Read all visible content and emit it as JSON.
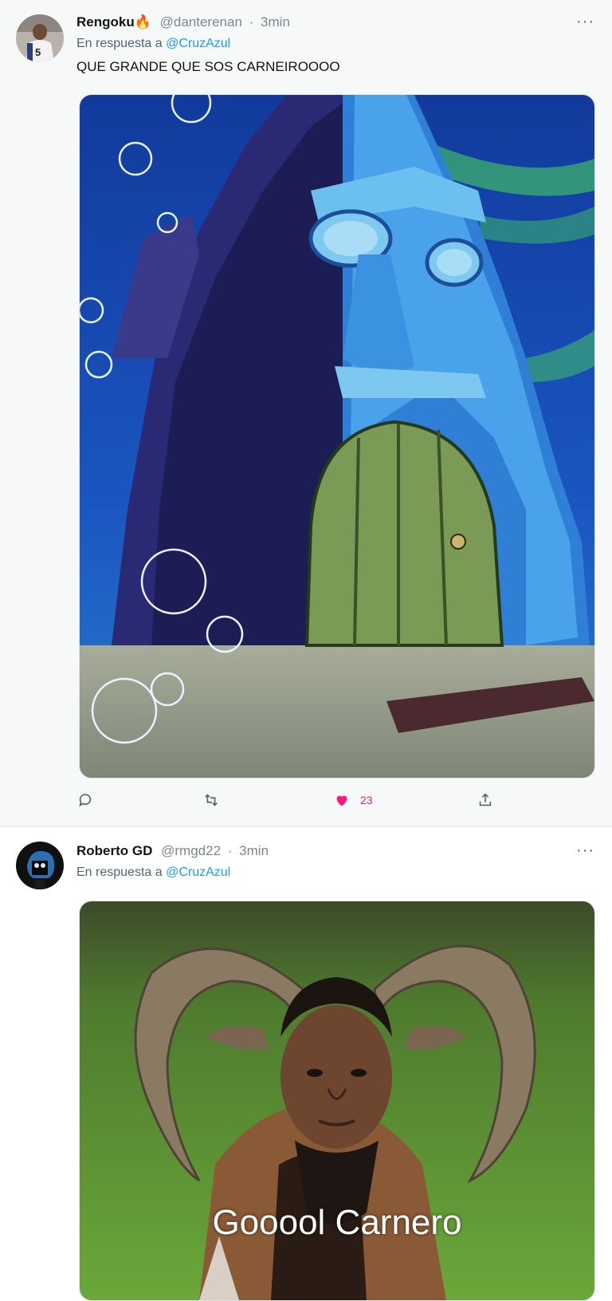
{
  "tweets": [
    {
      "name": "Rengoku🔥",
      "handle": "@danterenan",
      "time": "3min",
      "reply_label": "En respuesta a",
      "reply_mention": "@CruzAzul",
      "text": "QUE GRANDE QUE SOS CARNEIROOOO",
      "media_icon": "squidward-house-image",
      "actions": {
        "reply": "",
        "retweet": "",
        "likes": "23",
        "share": ""
      },
      "more_icon": "···"
    },
    {
      "name": "Roberto GD",
      "handle": "@rmgd22",
      "time": "3min",
      "reply_label": "En respuesta a",
      "reply_mention": "@CruzAzul",
      "media_icon": "ram-meme-image",
      "media_caption": "Gooool Carnero",
      "more_icon": "···"
    }
  ],
  "colors": {
    "accent": "#1d9bf0",
    "like": "#f91880",
    "muted": "#536471"
  }
}
